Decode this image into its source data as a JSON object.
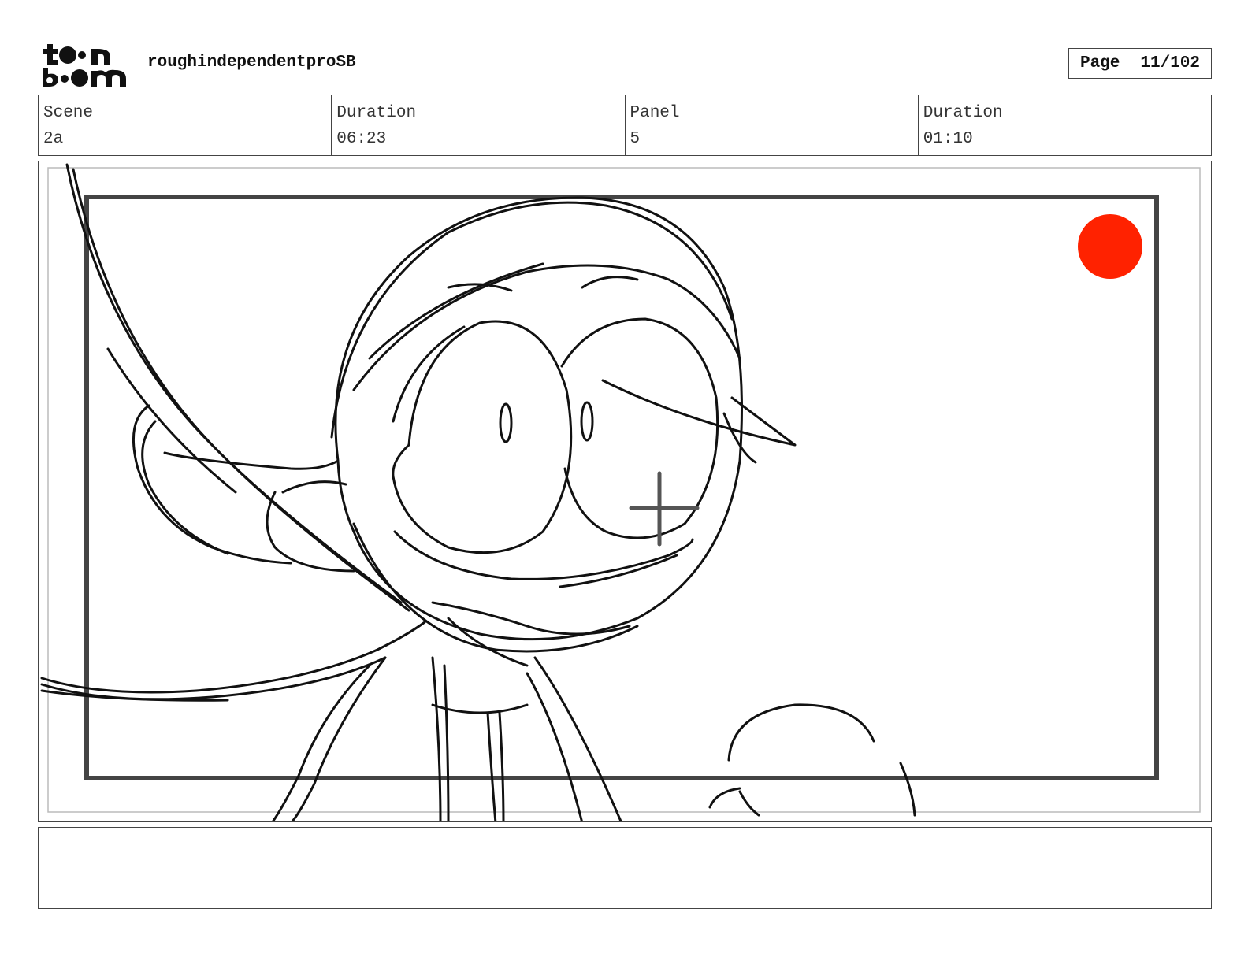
{
  "header": {
    "logo_name": "toon-boom-logo",
    "project_title": "roughindependentproSB",
    "page_label": "Page",
    "page_number": "11/102"
  },
  "info": {
    "scene_label": "Scene",
    "scene_value": "2a",
    "scene_duration_label": "Duration",
    "scene_duration_value": "06:23",
    "panel_label": "Panel",
    "panel_value": "5",
    "panel_duration_label": "Duration",
    "panel_duration_value": "01:10"
  },
  "panel": {
    "image_name": "storyboard-sketch",
    "record_dot_color": "#ff2200"
  },
  "notes": {
    "text": ""
  }
}
